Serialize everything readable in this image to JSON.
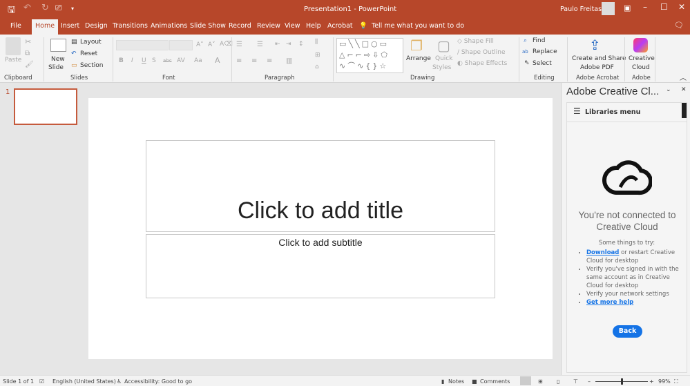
{
  "titlebar": {
    "title": "Presentation1  -  PowerPoint",
    "user": "Paulo Freitas",
    "qat_more": "▾"
  },
  "tabs": [
    "File",
    "Home",
    "Insert",
    "Design",
    "Transitions",
    "Animations",
    "Slide Show",
    "Record",
    "Review",
    "View",
    "Help",
    "Acrobat"
  ],
  "tell_me": "Tell me what you want to do",
  "ribbon": {
    "clipboard": {
      "paste": "Paste",
      "label": "Clipboard"
    },
    "slides": {
      "new_slide_1": "New",
      "new_slide_2": "Slide",
      "layout": "Layout",
      "reset": "Reset",
      "section": "Section",
      "label": "Slides"
    },
    "font": {
      "label": "Font",
      "aa": "Aa"
    },
    "paragraph": {
      "label": "Paragraph"
    },
    "drawing": {
      "arrange": "Arrange",
      "quick_styles_1": "Quick",
      "quick_styles_2": "Styles",
      "shape_fill": "Shape Fill",
      "shape_outline": "Shape Outline",
      "shape_effects": "Shape Effects",
      "label": "Drawing"
    },
    "editing": {
      "find": "Find",
      "replace": "Replace",
      "select": "Select",
      "label": "Editing"
    },
    "acrobat": {
      "create_1": "Create and Share",
      "create_2": "Adobe PDF",
      "label": "Adobe Acrobat"
    },
    "adobe": {
      "cc_1": "Creative",
      "cc_2": "Cloud",
      "label": "Adobe"
    }
  },
  "thumbnails": [
    {
      "number": "1"
    }
  ],
  "slide": {
    "title_placeholder": "Click to add title",
    "subtitle_placeholder": "Click to add subtitle"
  },
  "pane": {
    "title": "Adobe Creative Cl...",
    "menu": "Libraries menu",
    "heading": "You're not connected to Creative Cloud",
    "intro": "Some things to try:",
    "tips": [
      {
        "link": "Download",
        "text": " or restart Creative Cloud for desktop"
      },
      {
        "link": "",
        "text": "Verify you've signed in with the same account as in Creative Cloud for desktop"
      },
      {
        "link": "",
        "text": "Verify your network settings"
      },
      {
        "link": "Get more help",
        "text": ""
      }
    ],
    "back": "Back"
  },
  "status": {
    "slide": "Slide 1 of 1",
    "language": "English (United States)",
    "accessibility": "Accessibility: Good to go",
    "notes": "Notes",
    "comments": "Comments",
    "zoom": "99%",
    "zoom_level": 99
  },
  "colors": {
    "accent": "#b7472a",
    "link": "#1473e6"
  }
}
